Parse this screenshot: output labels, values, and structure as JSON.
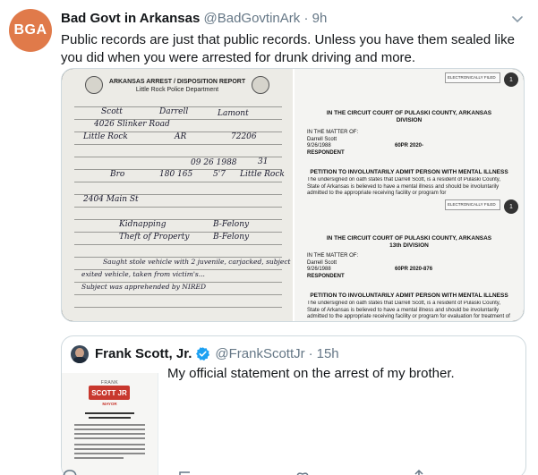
{
  "tweet": {
    "avatar_text": "BGA",
    "avatar_color": "#e07a4a",
    "display_name": "Bad Govt in Arkansas",
    "handle": "@BadGovtinArk",
    "separator": "·",
    "time": "9h",
    "text": "Public records are just that public records. Unless you have them sealed like you did when you were arrested for drunk driving and more."
  },
  "media": {
    "left_doc": {
      "title": "ARKANSAS ARREST / DISPOSITION REPORT",
      "subtitle": "Little Rock Police Department",
      "handwriting": [
        "Scott",
        "Darrell",
        "Lamont",
        "4026 Slinker Road",
        "Little Rock",
        "AR",
        "72206",
        "09 26 1988",
        "31",
        "Bro",
        "180 165",
        "5'7",
        "Little Rock",
        "2404 Main St",
        "Kidnapping",
        "B-Felony",
        "Theft of Property",
        "B-Felony",
        "Saught stole vehicle with 2 juvenile, carjacked, subject",
        "exited vehicle, taken from victim's...",
        "Subject was apprehended by NIRED"
      ]
    },
    "right_doc": {
      "stamp_1": "ELECTRONICALLY FILED",
      "badge_1": "1",
      "court_1": "IN THE CIRCUIT COURT OF PULASKI COUNTY, ARKANSAS",
      "division_1": "DIVISION",
      "matter_label": "IN THE MATTER OF:",
      "person": "Darrell Scott",
      "dob": "9/26/1988",
      "respondent": "RESPONDENT",
      "case_1": "60PR 2020-",
      "petition": "PETITION TO INVOLUNTARILY ADMIT PERSON WITH MENTAL ILLNESS",
      "petition_text": "The undersigned on oath states that Darrell Scott, is a resident of Pulaski County, State of Arkansas is believed to have a mental illness and should be involuntarily admitted to the appropriate receiving facility or program for",
      "stamp_2": "ELECTRONICALLY FILED",
      "badge_2": "1",
      "court_2": "IN THE CIRCUIT COURT OF PULASKI COUNTY, ARKANSAS",
      "division_2": "13th DIVISION",
      "case_2": "60PR 2020-876",
      "petition_text_2": "The undersigned on oath states that Darrell Scott, is a resident of Pulaski County, State of Arkansas is believed to have a mental illness and should be involuntarily admitted to the appropriate receiving facility or program for evaluation for treatment of mental illness. He is believed to be a clear and"
    }
  },
  "quote": {
    "display_name": "Frank Scott, Jr.",
    "handle": "@FrankScottJr",
    "separator": "·",
    "time": "15h",
    "text": "My official statement on the arrest of my brother.",
    "media_logo_top": "FRANK",
    "media_logo": "SCOTT JR",
    "media_logo_sub": "MAYOR",
    "verified_color": "#1da1f2"
  }
}
